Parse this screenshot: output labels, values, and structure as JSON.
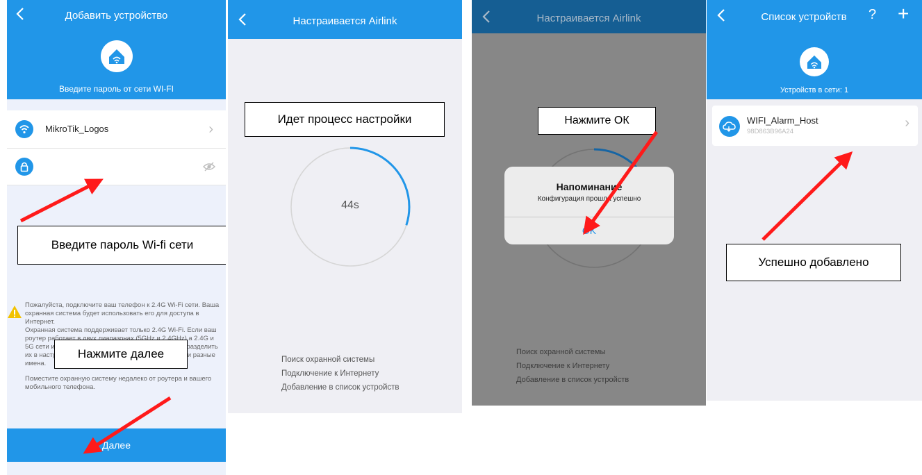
{
  "screen1": {
    "title": "Добавить устройство",
    "subtitle": "Введите пароль от сети WI-FI",
    "wifi_name": "MikroTik_Logos",
    "password_value": "",
    "callout_password": "Введите пароль Wi-fi сети",
    "warning_p1": "Пожалуйста, подключите ваш телефон к 2.4G Wi-Fi сети. Ваша охранная система будет использовать его для доступа в Интернет.",
    "warning_p2": "Охранная система поддерживает только 2.4G Wi-Fi. Если ваш роутер работает в двух диапазонах (5GHz и 2.4GHz) а 2.4G и 5G сети имеют одинаковые имена, вам необходимо разделить их в настройках роутера так, чтобы они использовали разные имена.",
    "warning_p3": "Поместите охранную систему недалеко от роутера и вашего мобильного телефона.",
    "callout_next": "Нажмите далее",
    "next_button": "Далее"
  },
  "screen2": {
    "title": "Настраивается Airlink",
    "callout": "Идет процесс настройки",
    "timer": "44s",
    "progress_fraction": 0.3,
    "steps": [
      "Поиск охранной системы",
      "Подключение к Интернету",
      "Добавление в список устройств"
    ]
  },
  "screen3": {
    "title": "Настраивается Airlink",
    "callout": "Нажмите ОК",
    "dialog_title": "Напоминание",
    "dialog_message": "Конфигурация прошла успешно",
    "dialog_ok": "OK",
    "steps": [
      "Поиск охранной системы",
      "Подключение к Интернету",
      "Добавление в список устройств"
    ]
  },
  "screen4": {
    "title": "Список устройств",
    "help_icon": "?",
    "add_icon": "+",
    "devices_count": "Устройств в сети: 1",
    "device_name": "WIFI_Alarm_Host",
    "device_id": "98D863B96A24",
    "callout": "Успешно добавлено"
  },
  "colors": {
    "accent": "#2196e8",
    "arrow": "#ff1a1a",
    "warning": "#f2c200"
  },
  "icons": [
    "back-chevron-icon",
    "house-wifi-icon",
    "wifi-icon",
    "lock-icon",
    "eye-hidden-icon",
    "chevron-right-icon",
    "warning-icon",
    "cloud-icon",
    "help-icon",
    "plus-icon"
  ]
}
